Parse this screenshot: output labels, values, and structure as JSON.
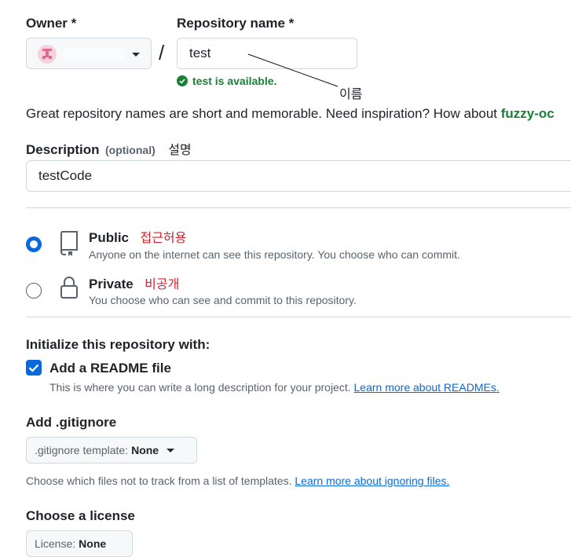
{
  "owner": {
    "label": "Owner *"
  },
  "separator": "/",
  "repo": {
    "label": "Repository name *",
    "value": "test",
    "availability": "test is available."
  },
  "annotations": {
    "name": "이름",
    "description": "설명",
    "public": "접근허용",
    "private": "비공개"
  },
  "inspiration": {
    "text": "Great repository names are short and memorable. Need inspiration? How about",
    "suggestion": "fuzzy-oc"
  },
  "description": {
    "label": "Description",
    "optional": "(optional)",
    "value": "testCode"
  },
  "visibility": {
    "public": {
      "title": "Public",
      "desc": "Anyone on the internet can see this repository. You choose who can commit.",
      "selected": true
    },
    "private": {
      "title": "Private",
      "desc": "You choose who can see and commit to this repository.",
      "selected": false
    }
  },
  "initialize": {
    "heading": "Initialize this repository with:",
    "readme_label": "Add a README file",
    "readme_checked": true,
    "readme_desc": "This is where you can write a long description for your project.",
    "readme_link": "Learn more about READMEs."
  },
  "gitignore": {
    "heading": "Add .gitignore",
    "select_prefix": ".gitignore template:",
    "select_value": "None",
    "desc": "Choose which files not to track from a list of templates.",
    "link": "Learn more about ignoring files."
  },
  "license": {
    "heading": "Choose a license",
    "select_prefix": "License:",
    "select_value": "None"
  },
  "colors": {
    "accent": "#0969da",
    "success": "#1a7f37",
    "annotation_red": "#d1242f"
  }
}
